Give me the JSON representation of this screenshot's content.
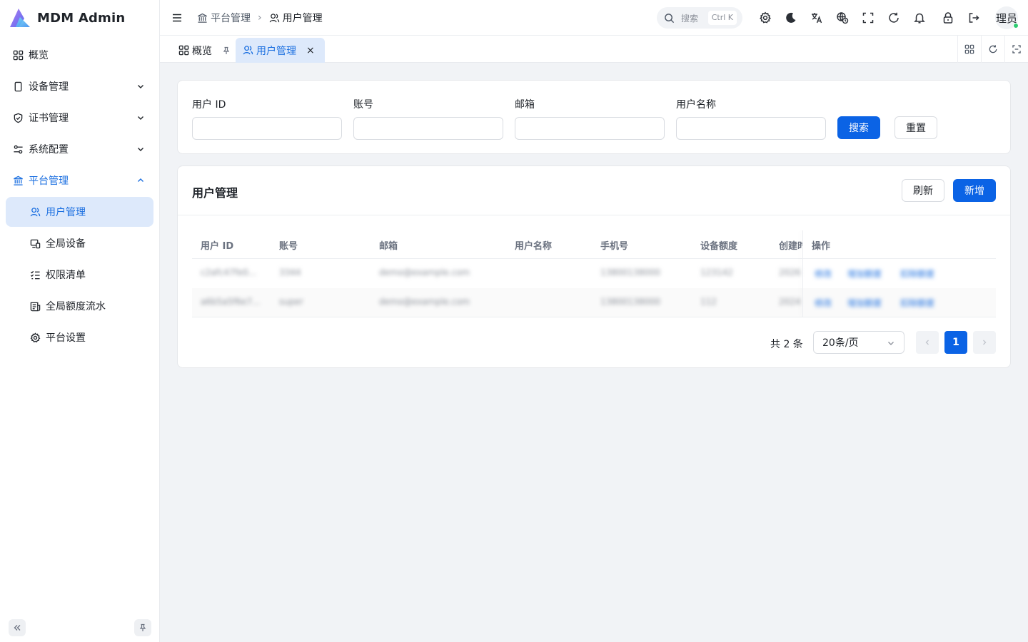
{
  "app": {
    "title": "MDM Admin"
  },
  "sidebar": {
    "items": [
      {
        "label": "概览",
        "icon": "dashboard-grid-icon"
      },
      {
        "label": "设备管理",
        "icon": "device-icon",
        "expandable": true
      },
      {
        "label": "证书管理",
        "icon": "shield-check-icon",
        "expandable": true
      },
      {
        "label": "系统配置",
        "icon": "settings-sliders-icon",
        "expandable": true
      },
      {
        "label": "平台管理",
        "icon": "bank-icon",
        "expandable": true,
        "open": true
      }
    ],
    "sub_items": [
      {
        "label": "用户管理",
        "icon": "users-icon",
        "active": true
      },
      {
        "label": "全局设备",
        "icon": "devices-icon"
      },
      {
        "label": "权限清单",
        "icon": "checklist-icon"
      },
      {
        "label": "全局额度流水",
        "icon": "ledger-icon"
      },
      {
        "label": "平台设置",
        "icon": "gear-icon"
      }
    ]
  },
  "header": {
    "breadcrumb": [
      "平台管理",
      "用户管理"
    ],
    "search_placeholder": "搜索",
    "search_shortcut": "Ctrl K",
    "avatar_text": "理员"
  },
  "tabs": [
    {
      "label": "概览",
      "pinned": true
    },
    {
      "label": "用户管理",
      "active": true
    }
  ],
  "filter": {
    "fields": [
      {
        "label": "用户 ID",
        "value": ""
      },
      {
        "label": "账号",
        "value": ""
      },
      {
        "label": "邮箱",
        "value": ""
      },
      {
        "label": "用户名称",
        "value": ""
      }
    ],
    "search_label": "搜索",
    "reset_label": "重置"
  },
  "table": {
    "title": "用户管理",
    "refresh_label": "刷新",
    "add_label": "新增",
    "columns": [
      "用户 ID",
      "账号",
      "邮箱",
      "用户名称",
      "手机号",
      "设备额度",
      "创建时",
      "操作"
    ],
    "rows": [
      [
        "c2afc47fe0...",
        "3344",
        "demo@example.com",
        "",
        "13800138000",
        "123142",
        "2026...",
        [
          "修改",
          "增加额度",
          "扣除额度"
        ]
      ],
      [
        "a6b5a5f6e7...",
        "super",
        "demo@example.com",
        "",
        "13800138000",
        "112",
        "2024...",
        [
          "修改",
          "增加额度",
          "扣除额度"
        ]
      ]
    ]
  },
  "pagination": {
    "total_text": "共 2 条",
    "page_size": "20条/页",
    "current_page": "1"
  },
  "colors": {
    "primary": "#0b63e5",
    "active_bg": "#dde9fb",
    "active_text": "#1b6fe0"
  }
}
